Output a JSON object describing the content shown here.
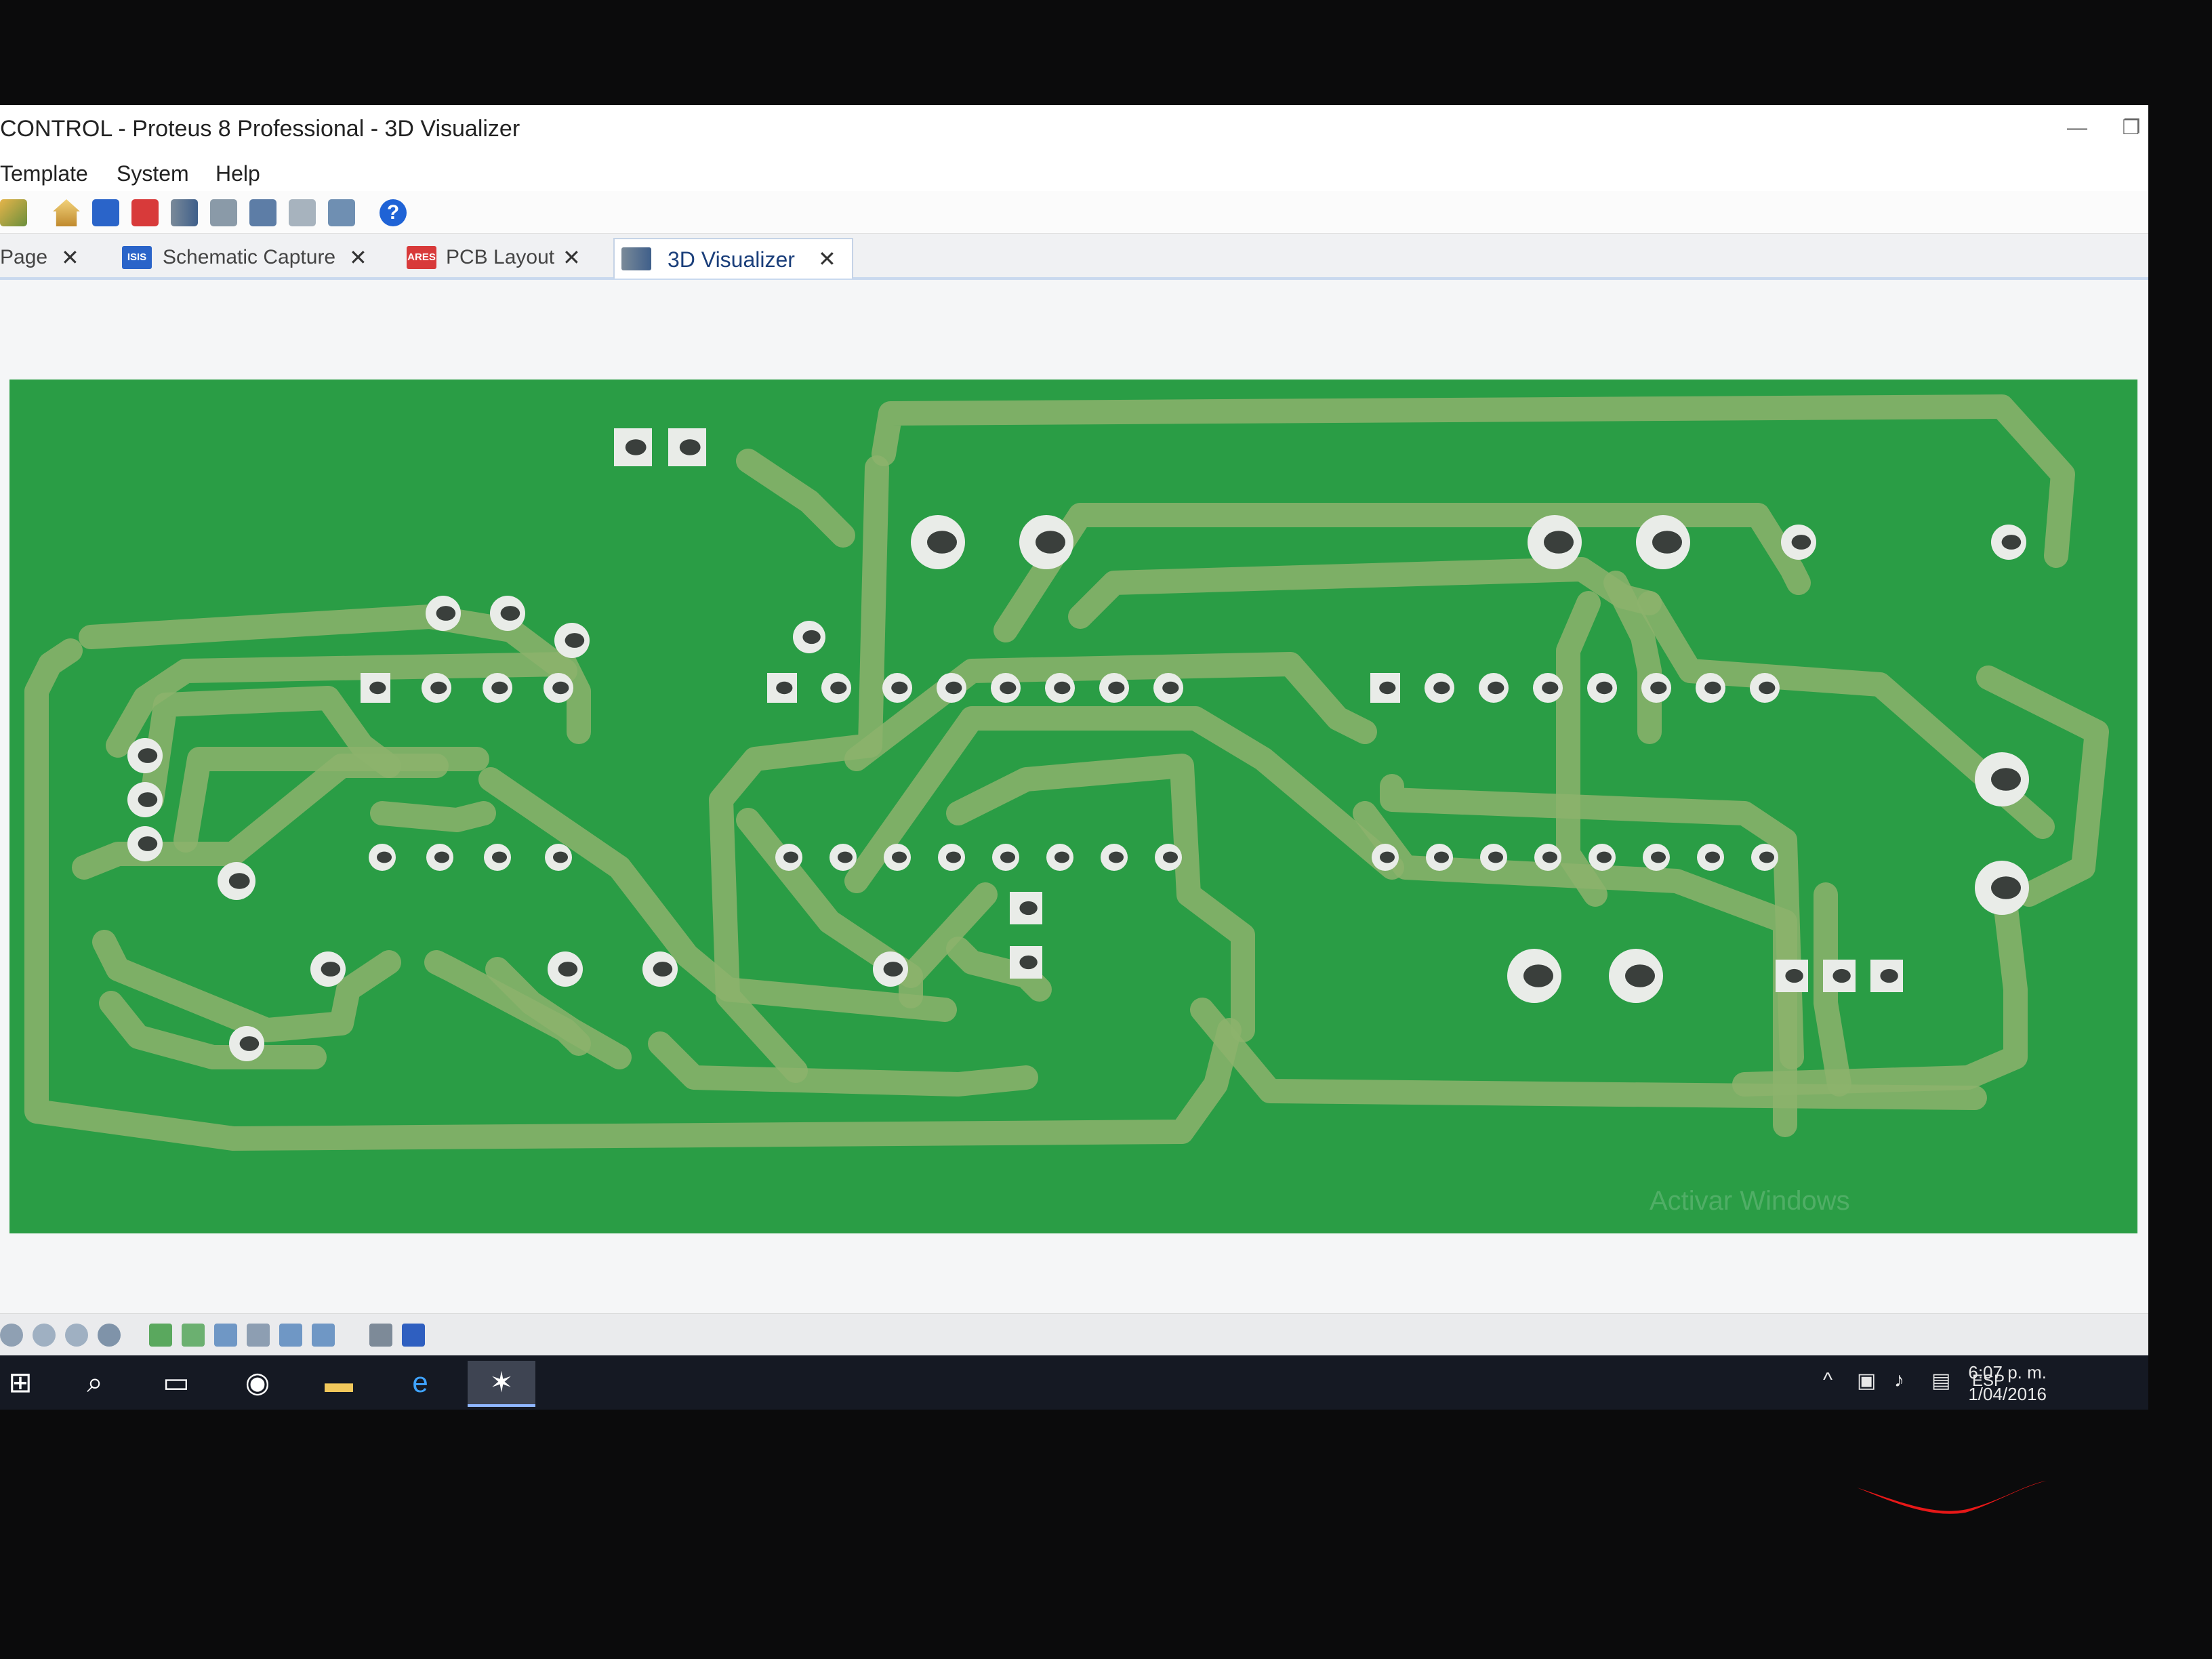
{
  "window": {
    "title": "CONTROL - Proteus 8 Professional - 3D Visualizer",
    "minimize_icon": "minimize-icon",
    "restore_icon": "restore-icon"
  },
  "menu": {
    "items": [
      "Template",
      "System",
      "Help"
    ]
  },
  "toolbar": {
    "buttons": [
      "open-project-icon",
      "home-icon",
      "isis-icon",
      "ares-icon",
      "3d-visualizer-icon",
      "gerber-viewer-icon",
      "bom-icon",
      "design-explorer-icon",
      "vsm-studio-icon",
      "help-icon"
    ],
    "help_glyph": "?"
  },
  "tabs": [
    {
      "label": "Page",
      "icon": "page-icon"
    },
    {
      "label": "Schematic Capture",
      "icon": "isis-icon",
      "badge": "ISIS"
    },
    {
      "label": "PCB Layout",
      "icon": "ares-icon",
      "badge": "ARES"
    },
    {
      "label": "3D Visualizer",
      "icon": "3d-visualizer-icon",
      "active": true
    }
  ],
  "tab_close_glyph": "✕",
  "board": {
    "color": "#2a9d45",
    "trace_color": "#8cb36c",
    "pad_color": "#e9ece8"
  },
  "watermark": "Activar Windows",
  "bottom_toolbar": [
    "pan-icon",
    "zoom-in-icon",
    "zoom-out-icon",
    "rotate-icon",
    "top-view-icon",
    "bottom-view-icon",
    "front-view-icon",
    "back-view-icon",
    "left-view-icon",
    "right-view-icon",
    "height-icon",
    "render-icon"
  ],
  "taskbar": {
    "apps": [
      "start-icon",
      "search-icon",
      "task-view-icon",
      "chrome-icon",
      "file-explorer-icon",
      "internet-explorer-icon",
      "proteus-icon"
    ],
    "tray": {
      "chevron": "^",
      "language": "ESP"
    },
    "time": "6:07 p. m.",
    "date": "1/04/2016"
  }
}
